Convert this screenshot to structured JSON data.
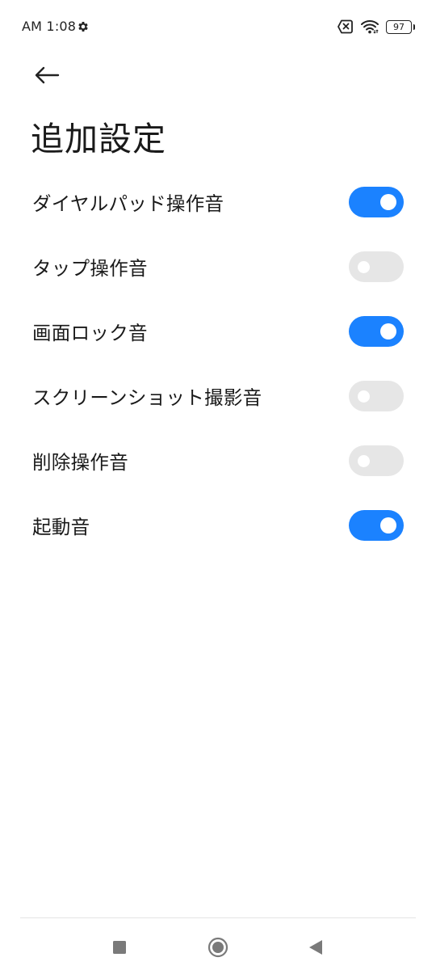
{
  "status_bar": {
    "time": "AM 1:08",
    "battery_level": "97"
  },
  "header": {
    "title": "追加設定"
  },
  "settings": [
    {
      "label": "ダイヤルパッド操作音",
      "enabled": true
    },
    {
      "label": "タップ操作音",
      "enabled": false
    },
    {
      "label": "画面ロック音",
      "enabled": true
    },
    {
      "label": "スクリーンショット撮影音",
      "enabled": false
    },
    {
      "label": "削除操作音",
      "enabled": false
    },
    {
      "label": "起動音",
      "enabled": true
    }
  ],
  "colors": {
    "toggle_on": "#1b82ff",
    "toggle_off": "#e6e6e6"
  },
  "icons": {
    "status_settings": "gear-icon",
    "sim": "no-sim-icon",
    "wifi": "wifi-icon",
    "back": "arrow-left-icon",
    "nav_recents": "square-icon",
    "nav_home": "circle-icon",
    "nav_back": "triangle-left-icon"
  }
}
